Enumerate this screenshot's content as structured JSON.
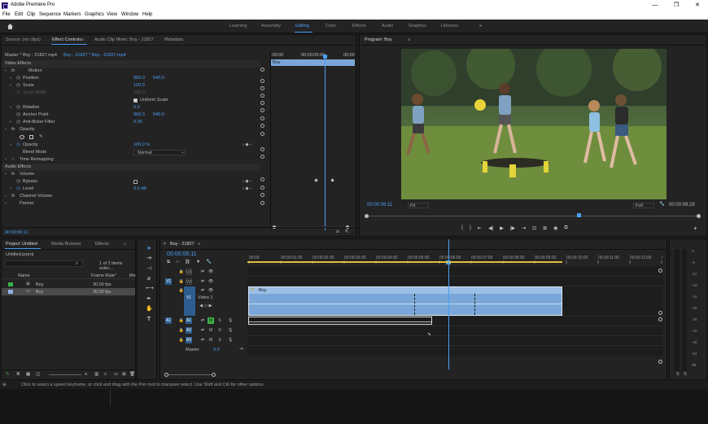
{
  "app": {
    "title": "Adobe Premiere Pro",
    "min": "—",
    "max": "❐",
    "close": "✕"
  },
  "menu": [
    "File",
    "Edit",
    "Clip",
    "Sequence",
    "Markers",
    "Graphics",
    "View",
    "Window",
    "Help"
  ],
  "workspaces": [
    "Learning",
    "Assembly",
    "Editing",
    "Color",
    "Effects",
    "Audio",
    "Graphics",
    "Libraries"
  ],
  "workspace_more": "»",
  "source_panel": {
    "tabs": [
      "Source: (no clips)",
      "Effect Controls",
      "Audio Clip Mixer: Boy - 21827",
      "Metadata"
    ],
    "tab_menu": "≡",
    "master": "Master * Boy - 21827.mp4",
    "clip_path": "Boy - 21827 * Boy - 21827.mp4",
    "ruler_start": ":00:00",
    "ruler_mid": "00:00:05:00",
    "ruler_end": "00:00",
    "clip_label": "Boy",
    "video_effects": "Video Effects",
    "motion": "Motion",
    "position_label": "Position",
    "position_x": "960.0",
    "position_y": "540.0",
    "scale_label": "Scale",
    "scale_val": "100.0",
    "scale_width_label": "Scale Width",
    "scale_width_val": "100.0",
    "uniform_scale": "Uniform Scale",
    "rotation_label": "Rotation",
    "rotation_val": "0.0",
    "anchor_label": "Anchor Point",
    "anchor_x": "960.0",
    "anchor_y": "540.0",
    "flicker_label": "Anti-flicker Filter",
    "flicker_val": "0.00",
    "opacity": "Opacity",
    "opacity_label": "Opacity",
    "opacity_val": "100.0 %",
    "blend_label": "Blend Mode",
    "blend_val": "Normal",
    "remap": "Time Remapping",
    "audio_effects": "Audio Effects",
    "volume": "Volume",
    "bypass_label": "Bypass",
    "level_label": "Level",
    "level_val": "0.0 dB",
    "channel_volume": "Channel Volume",
    "panner": "Panner",
    "timecode": "00:00:06:11"
  },
  "program": {
    "tab": "Program: Boy",
    "tab_menu": "≡",
    "timecode": "00:00:06:11",
    "fit": "Fit",
    "full": "Full",
    "duration": "00:00:09:29",
    "wrench": "🔧",
    "add": "+",
    "controls": [
      "{",
      "}",
      "⇤",
      "◀|",
      "▶",
      "|▶",
      "⇥",
      "⊡",
      "⊞",
      "◉",
      "⧉"
    ]
  },
  "project": {
    "tabs": [
      "Project: Untitled",
      "Media Browser",
      "Effects"
    ],
    "more": "»",
    "file": "Untitled.prproj",
    "selected": "1 of 2 items selec...",
    "col_name": "Name",
    "col_rate": "Frame Rate",
    "col_media": "Me",
    "items": [
      {
        "name": "Boy",
        "rate": "30.00 fps",
        "color": "#3cb043"
      },
      {
        "name": "Boy",
        "rate": "30.00 fps",
        "color": "#8fb3e6"
      }
    ]
  },
  "timeline": {
    "tab": "Boy - 21827",
    "tab_menu": "≡",
    "timecode": "00:00:06:11",
    "ruler": [
      "00:00",
      "00:00:01:00",
      "00:00:02:00",
      "00:00:03:00",
      "00:00:04:00",
      "00:00:05:00",
      "00:00:06:00",
      "00:00:07:00",
      "00:00:08:00",
      "00:00:09:00",
      "00:00:10:00",
      "00:00:11:00",
      "00:00:12:00",
      "00:00"
    ],
    "tracks": {
      "v3": "V3",
      "v2": "V2",
      "v1": "V1",
      "v1_src": "V1",
      "video1": "Video 1",
      "a1": "A1",
      "a1_src": "A1",
      "a2": "A2",
      "a3": "A3",
      "master": "Master",
      "master_val": "0.0",
      "m": "M",
      "s": "S"
    },
    "video_clip": "Boy",
    "audio_clip": "",
    "meter_scale": [
      "0",
      "-6",
      "-12",
      "-18",
      "-24",
      "-30",
      "-36",
      "-42",
      "-48",
      "-54",
      "dB"
    ],
    "meter_s": "S"
  },
  "status": "Click to select a speed keyframe, or click and drag with the Pen tool to marquee select. Use Shift and Ctrl for other options."
}
